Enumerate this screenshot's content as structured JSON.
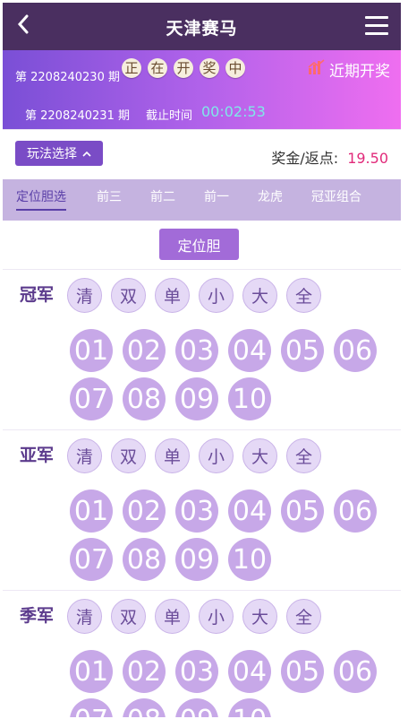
{
  "header": {
    "title": "天津赛马",
    "back_icon": "chevron-left-icon",
    "menu_icon": "menu-icon"
  },
  "banner": {
    "current_issue": "第 2208240230 期",
    "status_balls": [
      "正",
      "在",
      "开",
      "奖",
      "中"
    ],
    "recent_label": "近期开奖",
    "recent_icon": "bar-chart-icon",
    "next_issue": "第 2208240231 期",
    "deadline_label": "截止时间",
    "countdown": "00:02:53"
  },
  "play": {
    "select_label": "玩法选择",
    "prize_label": "奖金/返点:",
    "prize_value": "19.50"
  },
  "tabs": [
    "定位胆选",
    "前三",
    "前二",
    "前一",
    "龙虎",
    "冠亚组合"
  ],
  "active_tab": 0,
  "sub_button": "定位胆",
  "quick_picks": [
    "清",
    "双",
    "单",
    "小",
    "大",
    "全"
  ],
  "numbers": [
    "01",
    "02",
    "03",
    "04",
    "05",
    "06",
    "07",
    "08",
    "09",
    "10"
  ],
  "sections": [
    {
      "label": "冠军"
    },
    {
      "label": "亚军"
    },
    {
      "label": "季军"
    }
  ],
  "colors": {
    "header_bg": "#4a2f60",
    "tab_bar_bg": "#c5b3e0",
    "number_ball": "#c7a8e8",
    "quick_ball": "#e5d9f6",
    "prize_value": "#e12a7a",
    "countdown": "#7fe8e8"
  }
}
